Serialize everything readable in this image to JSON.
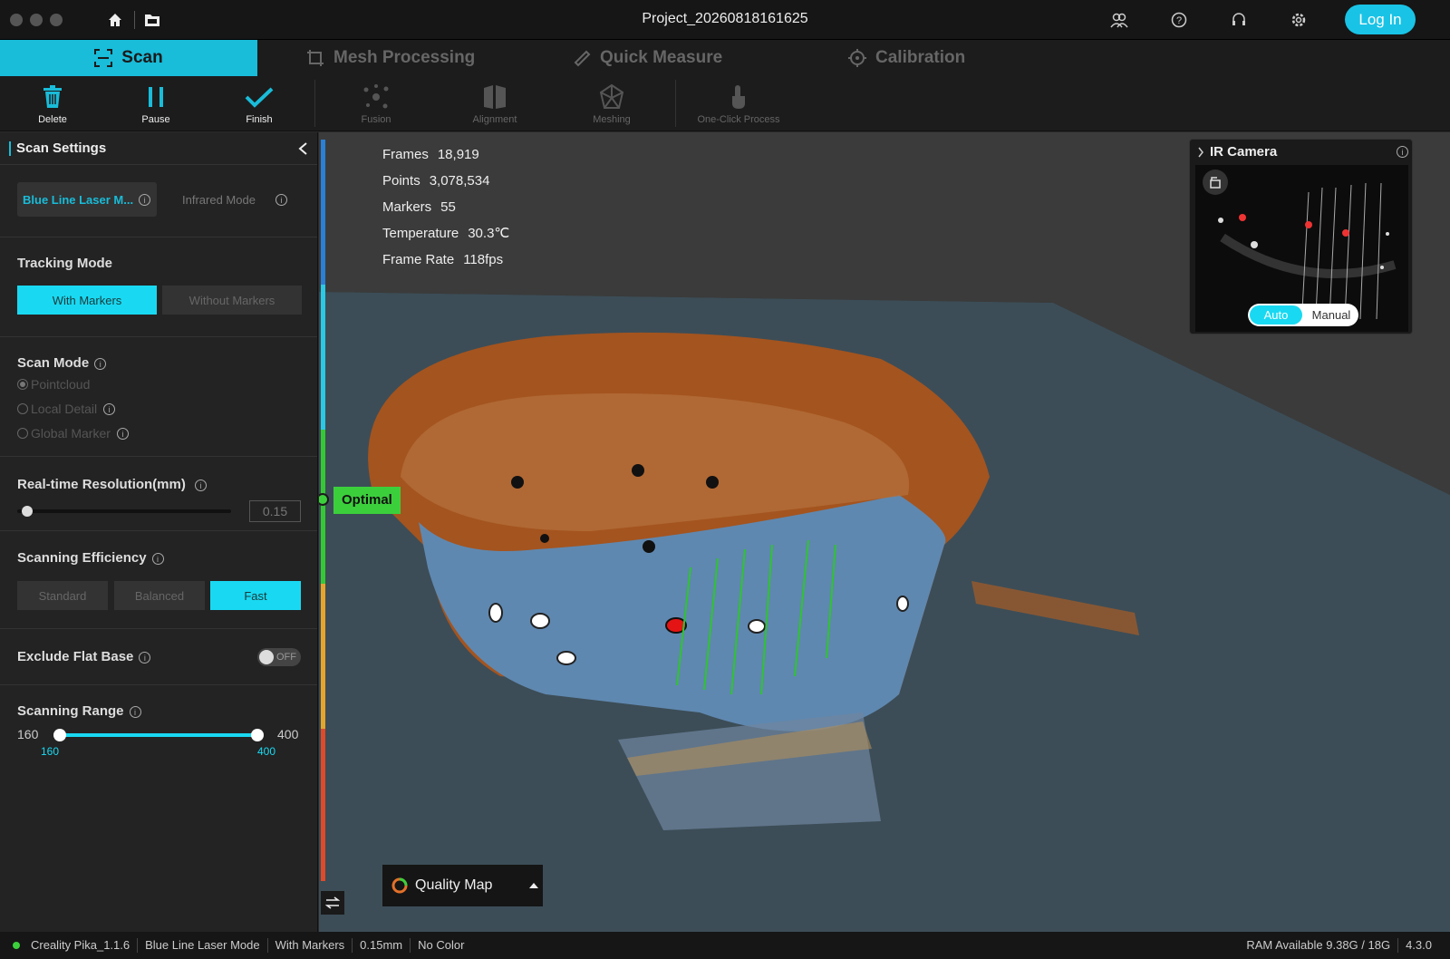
{
  "window": {
    "title": "Project_20260818161625",
    "login_label": "Log In"
  },
  "tabs": [
    {
      "label": "Scan",
      "icon": "scan-icon"
    },
    {
      "label": "Mesh Processing",
      "icon": "mesh-icon"
    },
    {
      "label": "Quick Measure",
      "icon": "ruler-icon"
    },
    {
      "label": "Calibration",
      "icon": "crosshair-icon"
    }
  ],
  "toolbar": {
    "delete": "Delete",
    "pause": "Pause",
    "finish": "Finish",
    "fusion": "Fusion",
    "alignment": "Alignment",
    "meshing": "Meshing",
    "one_click": "One-Click Process"
  },
  "sidebar": {
    "title": "Scan Settings",
    "modes": {
      "blue": "Blue Line Laser M...",
      "infrared": "Infrared Mode"
    },
    "tracking": {
      "title": "Tracking Mode",
      "with": "With Markers",
      "without": "Without Markers",
      "selected": "With Markers"
    },
    "scan_mode": {
      "title": "Scan Mode",
      "options": [
        "Pointcloud",
        "Local Detail",
        "Global Marker"
      ],
      "selected": "Pointcloud"
    },
    "resolution": {
      "title": "Real-time Resolution(mm)",
      "value": "0.15",
      "slider_fraction": 0.05
    },
    "efficiency": {
      "title": "Scanning Efficiency",
      "options": [
        "Standard",
        "Balanced",
        "Fast"
      ],
      "selected": "Fast"
    },
    "flat_base": {
      "title": "Exclude Flat Base",
      "toggle": "OFF"
    },
    "range": {
      "title": "Scanning Range",
      "min_label": "160",
      "max_label": "400",
      "low": "160",
      "high": "400"
    }
  },
  "stats": {
    "frames_label": "Frames",
    "frames": "18,919",
    "points_label": "Points",
    "points": "3,078,534",
    "markers_label": "Markers",
    "markers": "55",
    "temp_label": "Temperature",
    "temp": "30.3℃",
    "rate_label": "Frame Rate",
    "rate": "118fps"
  },
  "quality": {
    "indicator": "Optimal",
    "map_label": "Quality Map"
  },
  "ir_camera": {
    "title": "IR Camera",
    "auto": "Auto",
    "manual": "Manual",
    "selected": "Auto"
  },
  "status": {
    "device": "Creality Pika_1.1.6",
    "mode": "Blue Line Laser Mode",
    "tracking": "With Markers",
    "resolution": "0.15mm",
    "color": "No Color",
    "ram": "RAM Available 9.38G / 18G",
    "version": "4.3.0"
  },
  "colors": {
    "accent": "#19bcd9",
    "optimal": "#3ccf3c"
  }
}
